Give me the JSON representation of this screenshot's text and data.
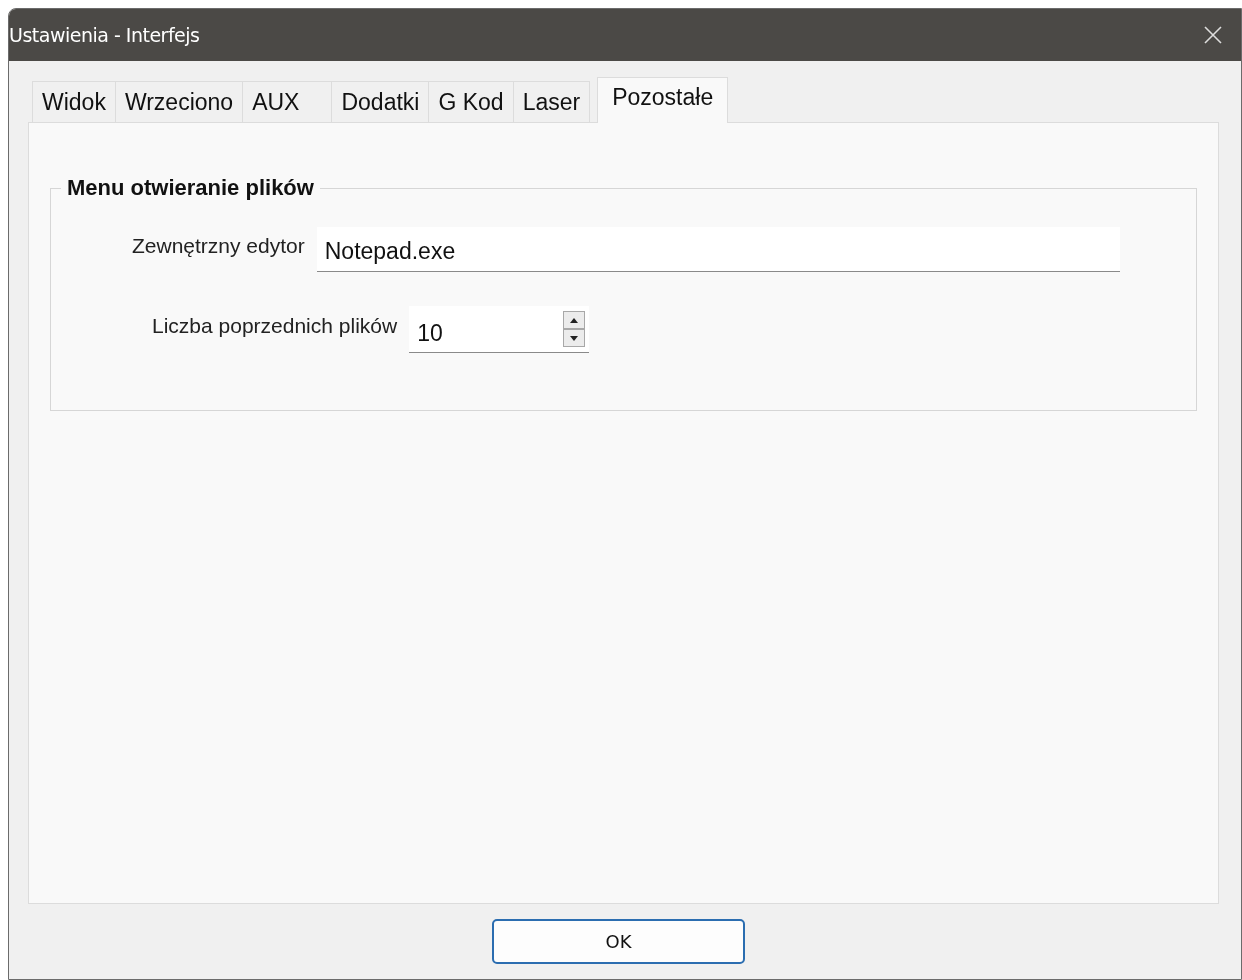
{
  "window": {
    "title": "Ustawienia - Interfejs"
  },
  "tabs": [
    {
      "label": "Widok",
      "selected": false
    },
    {
      "label": "Wrzeciono",
      "selected": false
    },
    {
      "label": "AUX",
      "selected": false
    },
    {
      "label": "Dodatki",
      "selected": false
    },
    {
      "label": "G Kod",
      "selected": false
    },
    {
      "label": "Laser",
      "selected": false
    },
    {
      "label": "Pozostałe",
      "selected": true
    }
  ],
  "group": {
    "title": "Menu otwieranie plików",
    "fields": [
      {
        "kind": "text",
        "label": "Zewnętrzny edytor",
        "value": "Notepad.exe"
      },
      {
        "kind": "spin",
        "label": "Liczba poprzednich plików",
        "value": "10"
      }
    ]
  },
  "buttons": [
    "OK"
  ]
}
